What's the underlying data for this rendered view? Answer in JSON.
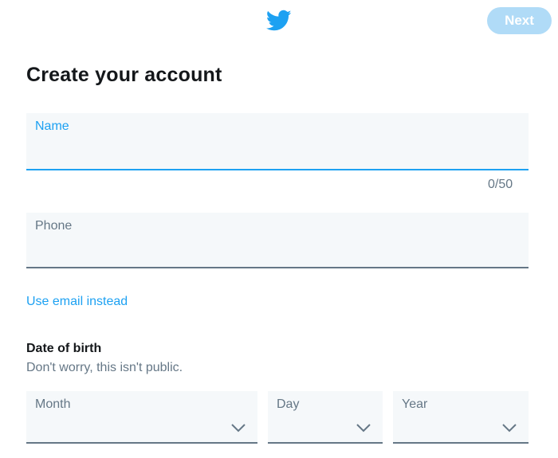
{
  "header": {
    "logo_icon": "twitter-bird-icon",
    "next_label": "Next"
  },
  "title": "Create your account",
  "name_field": {
    "label": "Name",
    "value": "",
    "counter": "0/50"
  },
  "phone_field": {
    "label": "Phone",
    "value": ""
  },
  "use_email_link": "Use email instead",
  "dob": {
    "title": "Date of birth",
    "subtitle": "Don't worry, this isn't public.",
    "month_label": "Month",
    "day_label": "Day",
    "year_label": "Year"
  },
  "colors": {
    "accent": "#1da1f2",
    "next_disabled": "#b0dbf7",
    "field_bg": "#f5f8fa",
    "muted_text": "#657786"
  }
}
